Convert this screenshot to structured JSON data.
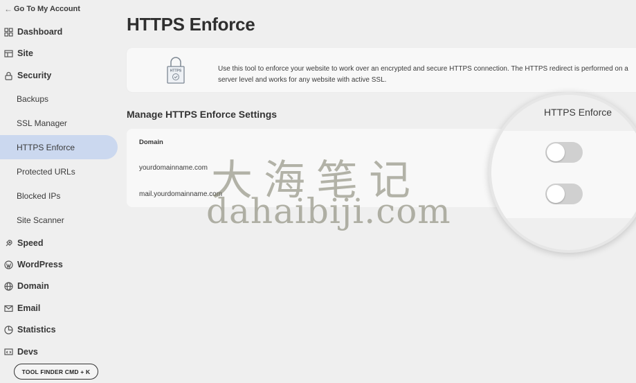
{
  "sidebar": {
    "back_label": "Go To My Account",
    "nav": [
      {
        "label": "Dashboard",
        "icon": "grid-icon"
      },
      {
        "label": "Site",
        "icon": "site-icon"
      },
      {
        "label": "Security",
        "icon": "lock-icon"
      }
    ],
    "security_sub": [
      {
        "label": "Backups"
      },
      {
        "label": "SSL Manager"
      },
      {
        "label": "HTTPS Enforce",
        "active": true
      },
      {
        "label": "Protected URLs"
      },
      {
        "label": "Blocked IPs"
      },
      {
        "label": "Site Scanner"
      }
    ],
    "nav_bottom": [
      {
        "label": "Speed",
        "icon": "rocket-icon"
      },
      {
        "label": "WordPress",
        "icon": "wordpress-icon"
      },
      {
        "label": "Domain",
        "icon": "globe-icon"
      },
      {
        "label": "Email",
        "icon": "mail-icon"
      },
      {
        "label": "Statistics",
        "icon": "pie-icon"
      },
      {
        "label": "Devs",
        "icon": "devs-icon"
      }
    ],
    "tool_finder_label": "TOOL FINDER CMD + K"
  },
  "main": {
    "title": "HTTPS Enforce",
    "info_icon_text": "HTTPS",
    "info_text": "Use this tool to enforce your website to work over an encrypted and secure HTTPS connection. The HTTPS redirect is performed on a server level and works for any website with active SSL.",
    "section_title": "Manage HTTPS Enforce Settings",
    "table": {
      "column_domain": "Domain",
      "column_toggle": "HTTPS Enforce",
      "rows": [
        {
          "domain": "yourdomainname.com",
          "enforced": false
        },
        {
          "domain": "mail.yourdomainname.com",
          "enforced": false
        }
      ]
    }
  },
  "watermark": {
    "cn": "大海笔记",
    "en": "dahaibiji.com"
  },
  "colors": {
    "background": "#efefef",
    "card": "#f8f8f8",
    "active_item": "#cbd8ef",
    "toggle_off": "#d0d0d0"
  }
}
